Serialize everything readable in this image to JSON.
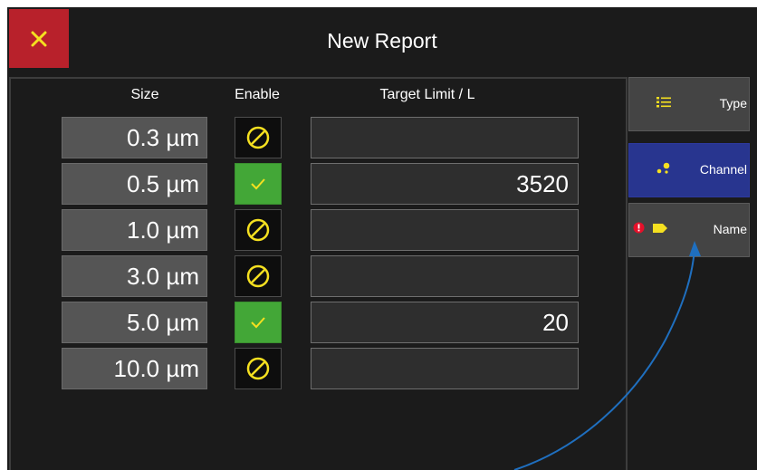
{
  "header": {
    "title": "New Report",
    "close_icon": "x-icon"
  },
  "table": {
    "headers": {
      "size": "Size",
      "enable": "Enable",
      "target": "Target Limit / L"
    },
    "rows": [
      {
        "size": "0.3 µm",
        "enabled": false,
        "target": ""
      },
      {
        "size": "0.5 µm",
        "enabled": true,
        "target": "3520"
      },
      {
        "size": "1.0 µm",
        "enabled": false,
        "target": ""
      },
      {
        "size": "3.0 µm",
        "enabled": false,
        "target": ""
      },
      {
        "size": "5.0 µm",
        "enabled": true,
        "target": "20"
      },
      {
        "size": "10.0 µm",
        "enabled": false,
        "target": ""
      }
    ]
  },
  "sidebar": {
    "tabs": [
      {
        "label": "Type",
        "icon": "list-icon",
        "active": false
      },
      {
        "label": "Channel",
        "icon": "dots-icon",
        "active": true
      },
      {
        "label": "Name",
        "icon": "tag-icon",
        "alert_icon": "alert-dot-icon",
        "active": false
      }
    ]
  },
  "colors": {
    "close_bg": "#b8212b",
    "accent_yellow": "#f5e020",
    "enabled_green": "#43a737",
    "active_tab": "#28358f",
    "alert_red": "#e5102a",
    "annotation_arrow": "#1f6fbf"
  }
}
